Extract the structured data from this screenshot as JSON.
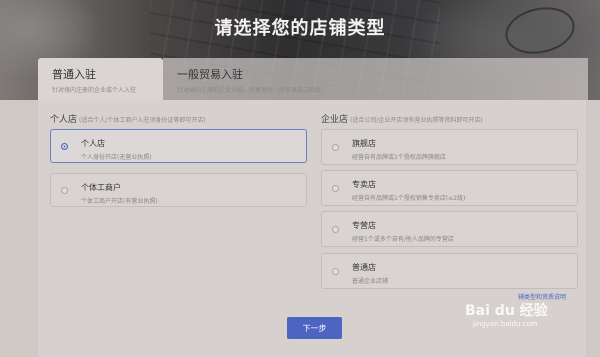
{
  "header": {
    "title": "请选择您的店铺类型"
  },
  "tabs": [
    {
      "label": "普通入驻",
      "sub": "针对境内注册的企业或个人入驻"
    },
    {
      "label": "一般贸易入驻",
      "sub": "针对境内注册的企业入驻，仅售卖所一般贸易进口商品"
    }
  ],
  "personal": {
    "title": "个人店",
    "note": "(适合个人/个体工商户入驻须身份证等即可开店)",
    "options": [
      {
        "title": "个人店",
        "desc": "个人身份开店(无营业执照)"
      },
      {
        "title": "个体工商户",
        "desc": "个体工商户开店(有营业执照)"
      }
    ]
  },
  "company": {
    "title": "企业店",
    "note": "(适合公司/企业开店须有营业执照等资料即可开店)",
    "options": [
      {
        "title": "旗舰店",
        "desc": "经营自有品牌或1个授权品牌旗舰店"
      },
      {
        "title": "专卖店",
        "desc": "经营自有品牌或1个授权销售专卖店(≤2级)"
      },
      {
        "title": "专营店",
        "desc": "经营1个或多个自有/他人品牌的专营店"
      },
      {
        "title": "普通店",
        "desc": "普通企业店铺"
      }
    ]
  },
  "help_link": "辅类型和资质说明",
  "next_button": "下一步",
  "watermark": {
    "main": "Bai du 经验",
    "sub": "jingyan.baidu.com"
  },
  "colors": {
    "accent": "#4d64c0"
  }
}
